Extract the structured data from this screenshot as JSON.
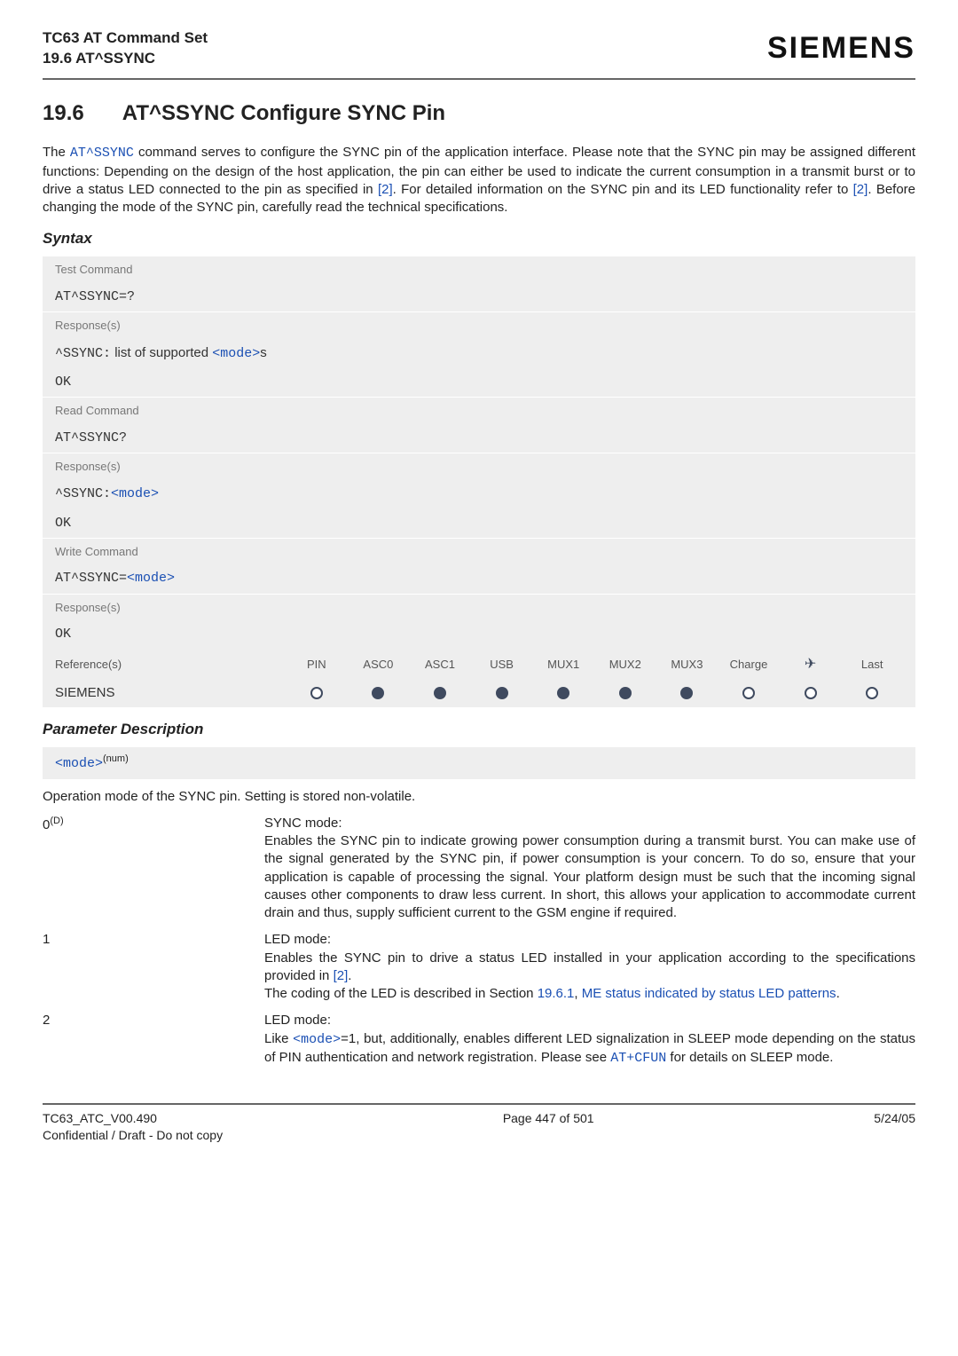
{
  "header": {
    "product": "TC63 AT Command Set",
    "section_ref": "19.6 AT^SSYNC",
    "brand": "SIEMENS"
  },
  "title": {
    "number": "19.6",
    "text": "AT^SSYNC   Configure SYNC Pin"
  },
  "intro": {
    "p1a": "The ",
    "p1_cmd": "AT^SSYNC",
    "p1b": " command serves to configure the SYNC pin of the application interface. Please note that the SYNC pin may be assigned different functions: Depending on the design of the host application, the pin can either be used to indicate the current consumption in a transmit burst or to drive a status LED connected to the pin as specified in ",
    "p1_ref1": "[2]",
    "p1c": ". For detailed information on the SYNC pin and its LED functionality refer to ",
    "p1_ref2": "[2]",
    "p1d": ". Before changing the mode of the SYNC pin, carefully read the technical specifications."
  },
  "syntax_label": "Syntax",
  "panel": {
    "test_label": "Test Command",
    "test_cmd": "AT^SSYNC=?",
    "resp_label": "Response(s)",
    "test_resp_prefix": "^SSYNC:",
    "test_resp_mid": "list of supported ",
    "test_resp_mode": "<mode>",
    "test_resp_suffix": "s",
    "ok": "OK",
    "read_label": "Read Command",
    "read_cmd": "AT^SSYNC?",
    "read_resp_prefix": "^SSYNC:",
    "read_resp_mode": "<mode>",
    "write_label": "Write Command",
    "write_cmd_prefix": "AT^SSYNC=",
    "write_cmd_mode": "<mode>",
    "ref_label": "Reference(s)",
    "ref_cols": [
      "PIN",
      "ASC0",
      "ASC1",
      "USB",
      "MUX1",
      "MUX2",
      "MUX3",
      "Charge",
      "",
      "Last"
    ],
    "ref_name": "SIEMENS"
  },
  "param_desc_label": "Parameter Description",
  "mode_token": "<mode>",
  "mode_sup": "(num)",
  "mode_intro": "Operation mode of the SYNC pin. Setting is stored non-volatile.",
  "defs": [
    {
      "key_main": "0",
      "key_sup": "(D)",
      "val_title": "SYNC mode:",
      "val_body": "Enables the SYNC pin to indicate growing power consumption during a transmit burst. You can make use of the signal generated by the SYNC pin, if power consumption is your concern. To do so, ensure that your application is capable of processing the signal. Your platform design must be such that the incoming signal causes other components to draw less current. In short, this allows your application to accommodate current drain and thus, supply sufficient current to the GSM engine if required."
    },
    {
      "key_main": "1",
      "key_sup": "",
      "val_title": "LED mode:",
      "val_body_a": "Enables the SYNC pin to drive a status LED installed in your application according to the specifications provided in ",
      "val_link1": "[2]",
      "val_body_b": ".",
      "val_body_c": "The coding of the LED is described in Section ",
      "val_link2": "19.6.1",
      "val_body_d": ", ",
      "val_link3": "ME status indicated by status LED patterns",
      "val_body_e": "."
    },
    {
      "key_main": "2",
      "key_sup": "",
      "val_title": "LED mode:",
      "val_body_a": "Like ",
      "val_link1": "<mode>",
      "val_body_b": "=1, but, additionally, enables different LED signalization in SLEEP mode depending on the status of PIN authentication and network registration. Please see ",
      "val_link2": "AT+CFUN",
      "val_body_c": " for details on SLEEP mode."
    }
  ],
  "footer": {
    "left1": "TC63_ATC_V00.490",
    "left2": "Confidential / Draft - Do not copy",
    "center": "Page 447 of 501",
    "right": "5/24/05"
  }
}
